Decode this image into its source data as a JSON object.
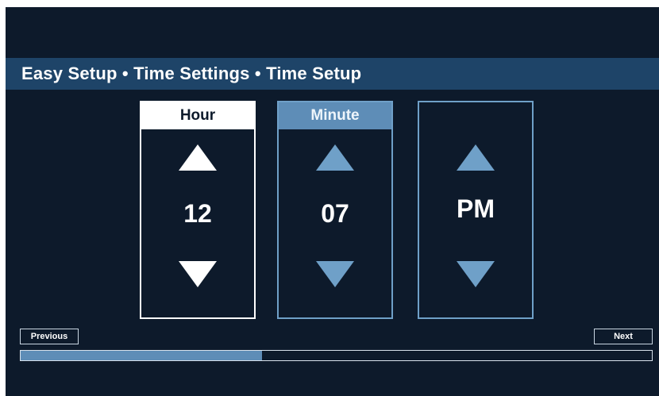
{
  "title": "Easy Setup • Time Settings • Time Setup",
  "spinners": [
    {
      "label": "Hour",
      "value": "12"
    },
    {
      "label": "Minute",
      "value": "07"
    },
    {
      "label": "",
      "value": "PM"
    }
  ],
  "nav": {
    "previous_label": "Previous",
    "next_label": "Next"
  },
  "progress": {
    "fraction": 0.383
  },
  "colors": {
    "background": "#0d1a2b",
    "title_bar": "#1e4468",
    "accent": "#5e8db7",
    "active": "#ffffff"
  },
  "icons": {
    "increase": "triangle-up-icon",
    "decrease": "triangle-down-icon"
  }
}
